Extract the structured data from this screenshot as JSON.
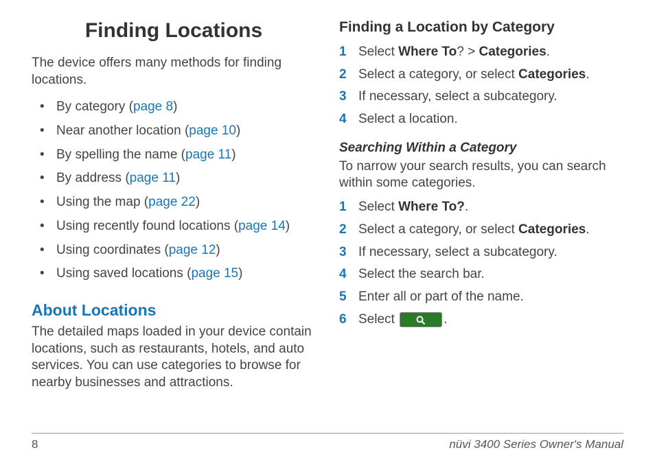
{
  "chapter_title": "Finding Locations",
  "intro": "The device offers many methods for finding locations.",
  "methods": [
    {
      "text": "By category (",
      "link": "page 8",
      "tail": ")"
    },
    {
      "text": "Near another location (",
      "link": "page 10",
      "tail": ")"
    },
    {
      "text": "By spelling the name (",
      "link": "page 11",
      "tail": ")"
    },
    {
      "text": "By address (",
      "link": "page 11",
      "tail": ")"
    },
    {
      "text": "Using the map (",
      "link": "page 22",
      "tail": ")"
    },
    {
      "text": "Using recently found locations (",
      "link": "page 14",
      "tail": ")"
    },
    {
      "text": "Using coordinates (",
      "link": "page 12",
      "tail": ")"
    },
    {
      "text": "Using saved locations (",
      "link": "page 15",
      "tail": ")"
    }
  ],
  "about_heading": "About Locations",
  "about_body": "The detailed maps loaded in your device contain locations, such as restaurants, hotels, and auto services. You can use categories to browse for nearby businesses and attractions.",
  "bycat_heading": "Finding a Location by Category",
  "bycat_steps": {
    "s1a": "Select ",
    "s1b": "Where To",
    "s1c": "? > ",
    "s1d": "Categories",
    "s1e": ".",
    "s2a": "Select a category, or select ",
    "s2b": "Categories",
    "s2c": ".",
    "s3": "If necessary, select a subcategory.",
    "s4": "Select a location."
  },
  "searchcat_heading": "Searching Within a Category",
  "searchcat_intro": "To narrow your search results, you can search within some categories.",
  "searchcat_steps": {
    "s1a": "Select ",
    "s1b": "Where To?",
    "s1c": ".",
    "s2a": "Select a category, or select ",
    "s2b": "Categories",
    "s2c": ".",
    "s3": "If necessary, select a subcategory.",
    "s4": "Select the search bar.",
    "s5": "Enter all or part of the name.",
    "s6a": "Select ",
    "s6b": "."
  },
  "footer": {
    "page": "8",
    "title": "nüvi 3400 Series Owner's Manual"
  }
}
